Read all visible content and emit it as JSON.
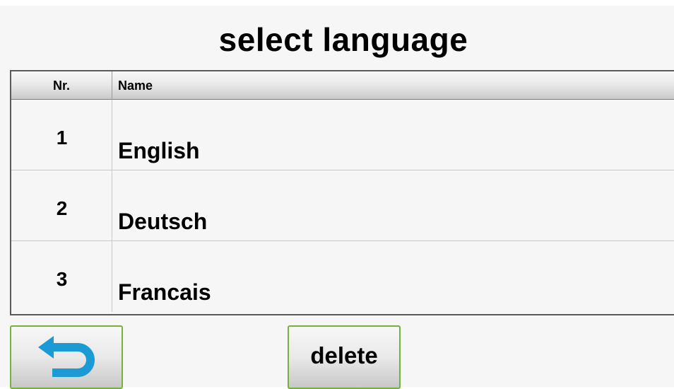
{
  "title": "select language",
  "table": {
    "columns": [
      "Nr.",
      "Name"
    ],
    "rows": [
      {
        "nr": "1",
        "name": "English"
      },
      {
        "nr": "2",
        "name": "Deutsch"
      },
      {
        "nr": "3",
        "name": "Francais"
      }
    ]
  },
  "buttons": {
    "back_icon": "back-arrow-icon",
    "delete_label": "delete"
  },
  "colors": {
    "button_border": "#74b23c",
    "back_arrow": "#1c9ad6",
    "background": "#f6f6f6"
  }
}
